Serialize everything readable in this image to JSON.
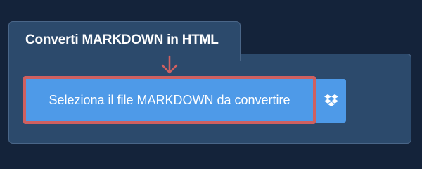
{
  "converter": {
    "title": "Converti MARKDOWN in HTML",
    "upload_label": "Seleziona il file MARKDOWN da convertire",
    "icons": {
      "pointer": "arrow-down-icon",
      "cloud": "dropbox-icon"
    }
  },
  "colors": {
    "page_background": "#14233a",
    "panel_background": "#2c4a6c",
    "button_background": "#4e9ae8",
    "highlight_border": "#d06060"
  }
}
